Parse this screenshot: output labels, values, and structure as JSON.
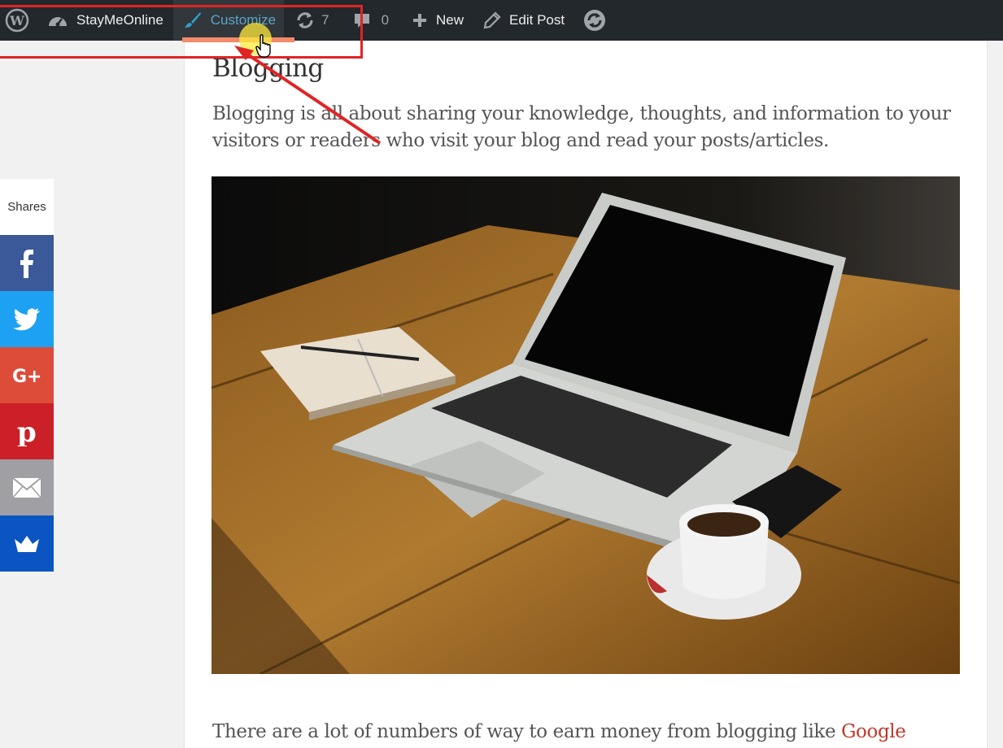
{
  "admin_bar": {
    "site_name": "StayMeOnline",
    "customize_label": "Customize",
    "updates_count": "7",
    "comments_count": "0",
    "new_label": "New",
    "edit_post_label": "Edit Post"
  },
  "post": {
    "heading": "Blogging",
    "intro": "Blogging is all about sharing your knowledge, thoughts, and information to your visitors or readers who visit your blog and read your posts/articles.",
    "body_text": "There are a lot of numbers of way to earn money from blogging like ",
    "body_link": "Google"
  },
  "share": {
    "label": "Shares",
    "buttons": [
      {
        "name": "facebook",
        "color": "#3b5998"
      },
      {
        "name": "twitter",
        "color": "#1da1f2"
      },
      {
        "name": "google-plus",
        "color": "#dd4b39"
      },
      {
        "name": "pinterest",
        "color": "#cb2027"
      },
      {
        "name": "email",
        "color": "#a0a0a4"
      },
      {
        "name": "sumo",
        "color": "#0a55c2"
      }
    ]
  },
  "colors": {
    "admin_bar_bg": "#23282d",
    "customize_text": "#5aa7c9",
    "annotation": "#e02424",
    "link": "#c0392b"
  },
  "icons": [
    "wordpress-logo-icon",
    "dashboard-icon",
    "brush-icon",
    "updates-icon",
    "comment-icon",
    "plus-icon",
    "pencil-icon",
    "sync-icon",
    "hand-cursor-icon"
  ]
}
